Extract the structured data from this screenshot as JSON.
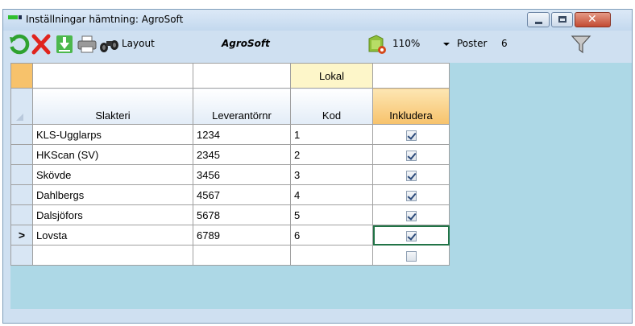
{
  "window": {
    "title": "Inställningar hämtning: AgroSoft",
    "close_glyph": "✕"
  },
  "toolbar": {
    "icons": [
      "refresh-icon",
      "delete-icon",
      "import-icon",
      "print-icon",
      "binoculars-icon",
      "report-settings-icon",
      "filter-icon"
    ],
    "layout_label": "Layout",
    "layout_value": "AgroSoft",
    "zoom_value": "110%",
    "poster_label": "Poster",
    "poster_value": "6"
  },
  "grid": {
    "band_label": "Lokal",
    "columns": [
      "Slakteri",
      "Leverantörnr",
      "Kod",
      "Inkludera"
    ],
    "rows": [
      {
        "slakteri": "KLS-Ugglarps",
        "leverantornr": "1234",
        "kod": "1",
        "inkludera": true
      },
      {
        "slakteri": "HKScan (SV)",
        "leverantornr": "2345",
        "kod": "2",
        "inkludera": true
      },
      {
        "slakteri": "Skövde",
        "leverantornr": "3456",
        "kod": "3",
        "inkludera": true
      },
      {
        "slakteri": "Dahlbergs",
        "leverantornr": "4567",
        "kod": "4",
        "inkludera": true
      },
      {
        "slakteri": "Dalsjöfors",
        "leverantornr": "5678",
        "kod": "5",
        "inkludera": true
      },
      {
        "slakteri": "Lovsta",
        "leverantornr": "6789",
        "kod": "6",
        "inkludera": true
      }
    ],
    "new_row_inkludera": false,
    "current_row_marker": ">",
    "current_row_index": 5
  },
  "colors": {
    "accent_header": "#f7c26b",
    "active_cell_border": "#217346",
    "grid_background": "#add8e6"
  }
}
